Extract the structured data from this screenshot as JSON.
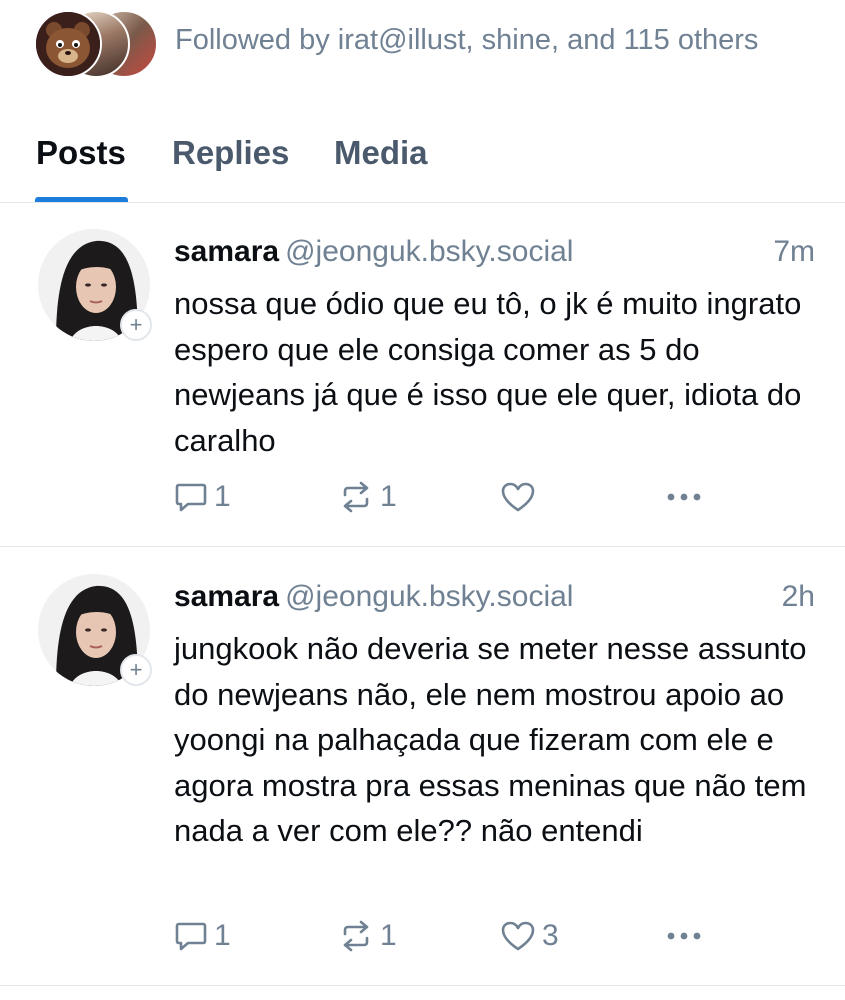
{
  "followed_by": {
    "text": "Followed by irat@illust, shine, and 115 others"
  },
  "tabs": [
    {
      "label": "Posts",
      "active": true
    },
    {
      "label": "Replies",
      "active": false
    },
    {
      "label": "Media",
      "active": false
    }
  ],
  "colors": {
    "accent": "#1d7ddc",
    "muted_text": "#6f8193",
    "tab_inactive": "#4a5a6c",
    "divider": "#e3e7eb"
  },
  "icons": {
    "follow_badge": "plus-icon",
    "reply": "chat-bubble-icon",
    "repost": "repost-arrows-icon",
    "like": "heart-icon",
    "more": "ellipsis-icon"
  },
  "posts": [
    {
      "author_name": "samara",
      "author_handle": "@jeonguk.bsky.social",
      "time": "7m",
      "text": "nossa que ódio que eu tô, o jk é muito ingrato espero que ele consiga comer as 5 do newjeans já que é isso que ele quer, idiota do caralho",
      "reply_count": "1",
      "repost_count": "1",
      "like_count": ""
    },
    {
      "author_name": "samara",
      "author_handle": "@jeonguk.bsky.social",
      "time": "2h",
      "text": "jungkook não deveria se meter nesse assunto do newjeans não, ele nem mostrou apoio ao yoongi na palhaçada que fizeram com ele e agora mostra pra essas meninas que não tem nada a ver com ele?? não entendi",
      "reply_count": "1",
      "repost_count": "1",
      "like_count": "3"
    }
  ]
}
